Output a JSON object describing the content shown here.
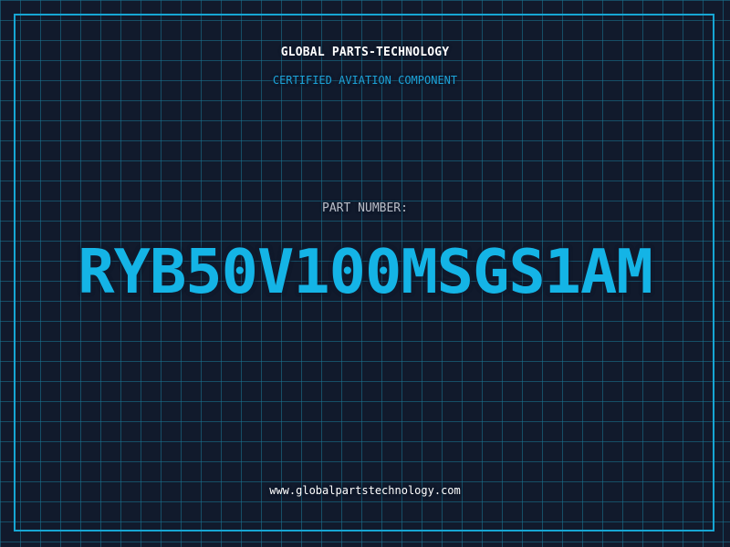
{
  "header": {
    "company": "GLOBAL PARTS-TECHNOLOGY",
    "subtitle": "CERTIFIED AVIATION COMPONENT"
  },
  "part": {
    "label": "PART NUMBER:",
    "number": "RYB50V100MSGS1AM"
  },
  "footer": {
    "website": "www.globalpartstechnology.com"
  },
  "colors": {
    "background": "#111a2c",
    "grid": "#1a7896",
    "frame": "#16a6d4",
    "accent": "#14b4e6",
    "label": "#b9bec8",
    "text": "#ffffff"
  }
}
